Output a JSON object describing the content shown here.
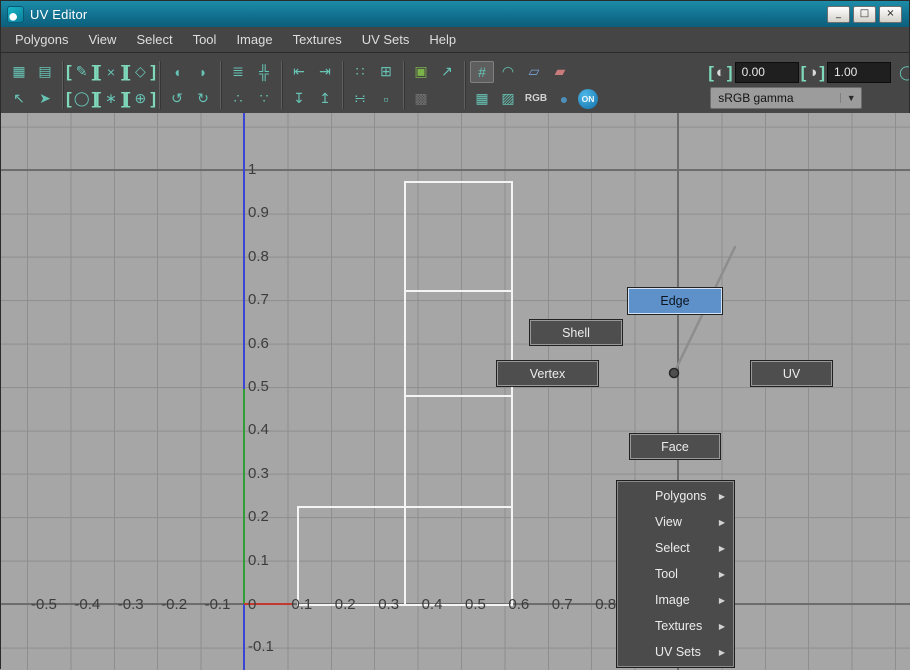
{
  "window": {
    "title": "UV Editor",
    "controls": {
      "minimize": "_",
      "maximize": "□",
      "close": "×"
    }
  },
  "menu_bar": {
    "items": [
      "Polygons",
      "View",
      "Select",
      "Tool",
      "Image",
      "Textures",
      "UV Sets",
      "Help"
    ]
  },
  "toolbar": {
    "groups": [
      {
        "top": [
          {
            "name": "uv-lattice-icon",
            "glyph": "▦"
          },
          {
            "name": "move-uv-shell-icon",
            "glyph": "▤"
          }
        ],
        "bottom": [
          {
            "name": "select-cursor-icon",
            "glyph": "↖"
          },
          {
            "name": "pick-cursor-icon",
            "glyph": "➤"
          }
        ]
      },
      {
        "top": [
          {
            "name": "pencil-tool-icon",
            "glyph": "✎",
            "bracket": true
          },
          {
            "name": "cut-uv-tool-icon",
            "glyph": "×",
            "bracket": true
          },
          {
            "name": "sew-uv-tool-icon",
            "glyph": "◇",
            "bracket": true
          }
        ],
        "bottom": [
          {
            "name": "smooth-uv-tool-icon",
            "glyph": "◯",
            "bracket": true
          },
          {
            "name": "symmetrize-tool-icon",
            "glyph": "∗",
            "bracket": true
          },
          {
            "name": "grab-uv-tool-icon",
            "glyph": "⊕",
            "bracket": true
          }
        ]
      },
      {
        "top": [
          {
            "name": "flip-u-icon",
            "glyph": "◖"
          },
          {
            "name": "flip-v-icon",
            "glyph": "◗"
          }
        ],
        "bottom": [
          {
            "name": "rotate-ccw-icon",
            "glyph": "↺"
          },
          {
            "name": "rotate-cw-icon",
            "glyph": "↻"
          }
        ]
      },
      {
        "top": [
          {
            "name": "align-shells-icon",
            "glyph": "≣"
          },
          {
            "name": "layout-uvs-icon",
            "glyph": "╬"
          }
        ],
        "bottom": [
          {
            "name": "distribute-u-icon",
            "glyph": "∴"
          },
          {
            "name": "distribute-v-icon",
            "glyph": "∵"
          }
        ]
      },
      {
        "top": [
          {
            "name": "align-left-icon",
            "glyph": "⇤"
          },
          {
            "name": "align-right-icon",
            "glyph": "⇥"
          }
        ],
        "bottom": [
          {
            "name": "align-bottom-icon",
            "glyph": "↧"
          },
          {
            "name": "align-top-icon",
            "glyph": "↥"
          }
        ]
      },
      {
        "top": [
          {
            "name": "gather-uvs-icon",
            "glyph": "∷"
          },
          {
            "name": "stack-shells-icon",
            "glyph": "⊞"
          }
        ],
        "bottom": [
          {
            "name": "randomize-shells-icon",
            "glyph": "∺"
          },
          {
            "name": "single-tile-icon",
            "glyph": "▫"
          }
        ]
      },
      {
        "top": [
          {
            "name": "uv-snapshot-icon",
            "glyph": "▣",
            "color": "#7bb24a"
          },
          {
            "name": "frame-all-icon",
            "glyph": "↗"
          }
        ],
        "bottom": [
          {
            "name": "checker-map-icon",
            "glyph": "▩",
            "color": "#707070"
          }
        ]
      },
      {
        "top": [
          {
            "name": "grid-display-icon",
            "glyph": "#",
            "active": true
          },
          {
            "name": "distortion-display-icon",
            "glyph": "◠"
          },
          {
            "name": "overlap-display-icon",
            "glyph": "▱",
            "color": "#7aa0d8"
          },
          {
            "name": "flipped-display-icon",
            "glyph": "▰",
            "color": "#c97a7a"
          }
        ],
        "bottom": [
          {
            "name": "texture-grid-icon",
            "glyph": "▦"
          },
          {
            "name": "dither-display-icon",
            "glyph": "▨"
          },
          {
            "name": "rgb-channels-button",
            "glyph": "RGB",
            "text": true
          },
          {
            "name": "alpha-channel-icon",
            "glyph": "●",
            "color": "#4d8fb8"
          },
          {
            "name": "on-toggle-button",
            "glyph": "ON",
            "pill": "blue"
          }
        ]
      }
    ],
    "exposure": {
      "value": "0.00"
    },
    "gamma": {
      "value": "1.00"
    },
    "colorspace": {
      "value": "sRGB gamma"
    }
  },
  "canvas": {
    "x_ticks": [
      "-0.5",
      "-0.4",
      "-0.3",
      "-0.2",
      "-0.1",
      "0",
      "0.1",
      "0.2",
      "0.3",
      "0.4",
      "0.5",
      "0.6",
      "0.7",
      "0.8"
    ],
    "y_ticks": [
      "1",
      "0.9",
      "0.8",
      "0.7",
      "0.6",
      "0.5",
      "0.4",
      "0.3",
      "0.2",
      "0.1",
      "-0.1"
    ]
  },
  "marking_menu": {
    "center_items": [
      {
        "label": "Edge",
        "highlighted": true
      },
      {
        "label": "Shell",
        "highlighted": false
      },
      {
        "label": "Vertex",
        "highlighted": false
      },
      {
        "label": "UV",
        "highlighted": false
      },
      {
        "label": "Face",
        "highlighted": false
      }
    ],
    "menu_items": [
      "Polygons",
      "View",
      "Select",
      "Tool",
      "Image",
      "Textures",
      "UV Sets"
    ]
  },
  "colors": {
    "titlebar": "#11718f",
    "panel": "#454545",
    "canvas_bg": "#a6a6a6",
    "icon_teal": "#67c3b4",
    "highlight_blue": "#5e90ca",
    "axis_blue": "#3a45d6",
    "axis_green": "#2f9e33",
    "axis_red": "#c23a2e",
    "shell_outline": "#f4f4f4"
  }
}
